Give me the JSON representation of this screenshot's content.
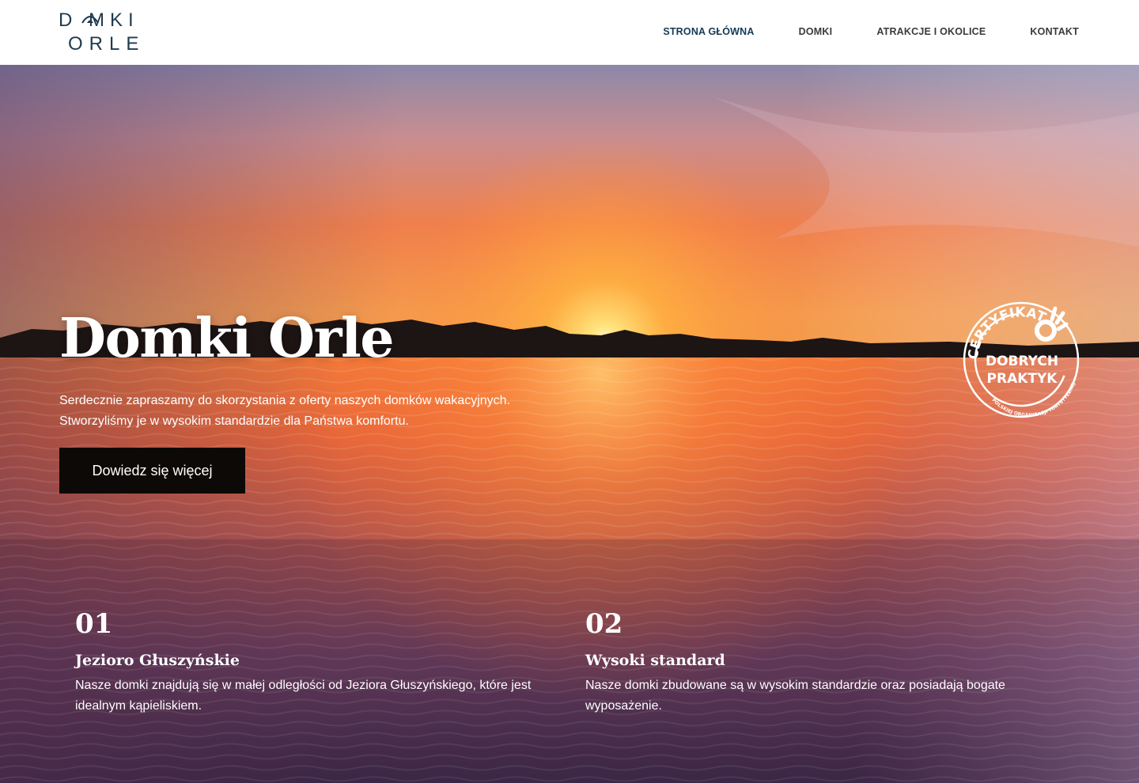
{
  "logo": {
    "line1": "D MKI",
    "line2": "ORLE"
  },
  "nav": {
    "items": [
      {
        "label": "STRONA GŁÓWNA"
      },
      {
        "label": "DOMKI"
      },
      {
        "label": "ATRAKCJE I OKOLICE"
      },
      {
        "label": "KONTAKT"
      }
    ]
  },
  "hero": {
    "title": "Domki Orle",
    "text": "Serdecznie zapraszamy do skorzystania z oferty naszych domków wakacyjnych. Stworzyliśmy je w wysokim standardzie dla Państwa komfortu.",
    "button_label": "Dowiedz się więcej"
  },
  "badge": {
    "top": "CERTYFIKAT",
    "line1": "DOBRYCH",
    "line2": "PRAKTYK",
    "bottom": "POLSKIEJ ORGANIZACJI TURYSTYCZNEJ"
  },
  "features": [
    {
      "number": "01",
      "title": "Jezioro Głuszyńskie",
      "text": "Nasze domki znajdują się w małej odległości od Jeziora Głuszyńskiego, które jest idealnym kąpieliskiem."
    },
    {
      "number": "02",
      "title": "Wysoki standard",
      "text": "Nasze domki zbudowane są w wysokim standardzie oraz posiadają bogate wyposażenie."
    }
  ],
  "colors": {
    "nav_active": "#153a55",
    "nav_text": "#3a3a3a",
    "button_bg": "#0d0906",
    "logo": "#1f3a4d"
  }
}
